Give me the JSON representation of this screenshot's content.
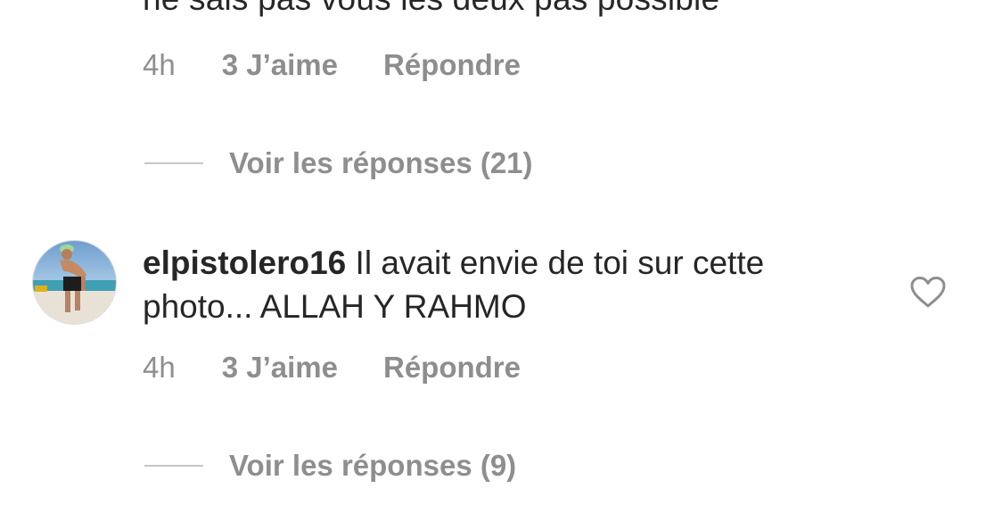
{
  "previous_comment": {
    "text_tail": "ne sais pas vous les deux pas possible",
    "time": "4h",
    "likes": "3 J’aime",
    "reply_label": "Répondre",
    "view_replies": "Voir les réponses (21)"
  },
  "comment": {
    "username": "elpistolero16",
    "text": "Il avait envie de toi sur cette photo... ALLAH Y RAHMO",
    "time": "4h",
    "likes": "3 J’aime",
    "reply_label": "Répondre",
    "view_replies": "Voir les réponses (9)",
    "avatar_icon": "avatar",
    "like_icon": "heart-outline-icon"
  },
  "colors": {
    "text_primary": "#262626",
    "text_secondary": "#8e8e8e",
    "divider": "#c7c7c7",
    "icon": "#8e8e8e"
  }
}
